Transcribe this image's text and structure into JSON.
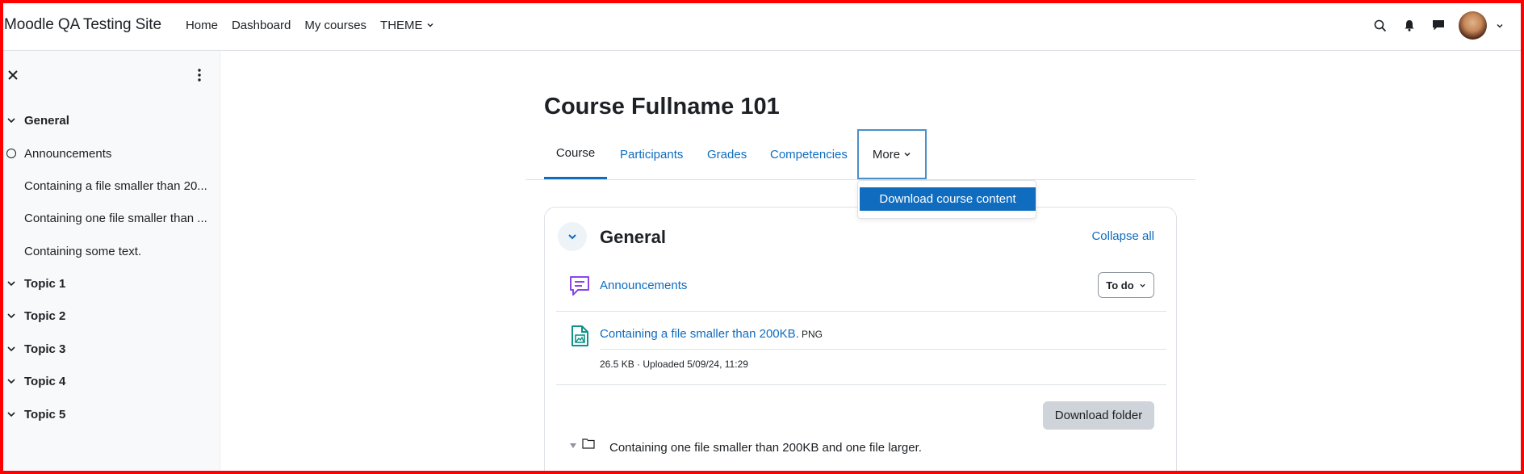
{
  "navbar": {
    "brand": "Moodle QA Testing Site",
    "links": [
      "Home",
      "Dashboard",
      "My courses",
      "THEME"
    ],
    "icons": [
      "search-icon",
      "bell-icon",
      "chat-icon",
      "avatar",
      "chevron-down-icon"
    ]
  },
  "sidebar": {
    "sections": [
      {
        "label": "General",
        "items": [
          "Announcements",
          "Containing a file smaller than 20...",
          "Containing one file smaller than ...",
          "Containing some text."
        ]
      },
      {
        "label": "Topic 1"
      },
      {
        "label": "Topic 2"
      },
      {
        "label": "Topic 3"
      },
      {
        "label": "Topic 4"
      },
      {
        "label": "Topic 5"
      }
    ]
  },
  "course": {
    "title": "Course Fullname 101",
    "tabs": [
      "Course",
      "Participants",
      "Grades",
      "Competencies"
    ],
    "more_label": "More",
    "more_menu": [
      "Download course content"
    ]
  },
  "section": {
    "title": "General",
    "collapse_all": "Collapse all",
    "activities": {
      "announcements": {
        "name": "Announcements",
        "todo": "To do"
      },
      "file": {
        "name": "Containing a file smaller than 200KB.",
        "badge": "PNG",
        "meta": "26.5 KB · Uploaded 5/09/24, 11:29"
      },
      "folder": {
        "button": "Download folder",
        "name": "Containing one file smaller than 200KB and one file larger."
      }
    }
  },
  "colors": {
    "accent": "#0f6cbf",
    "frame": "#ff0000",
    "forum_icon": "#8a47e6",
    "file_icon": "#0d9488"
  }
}
